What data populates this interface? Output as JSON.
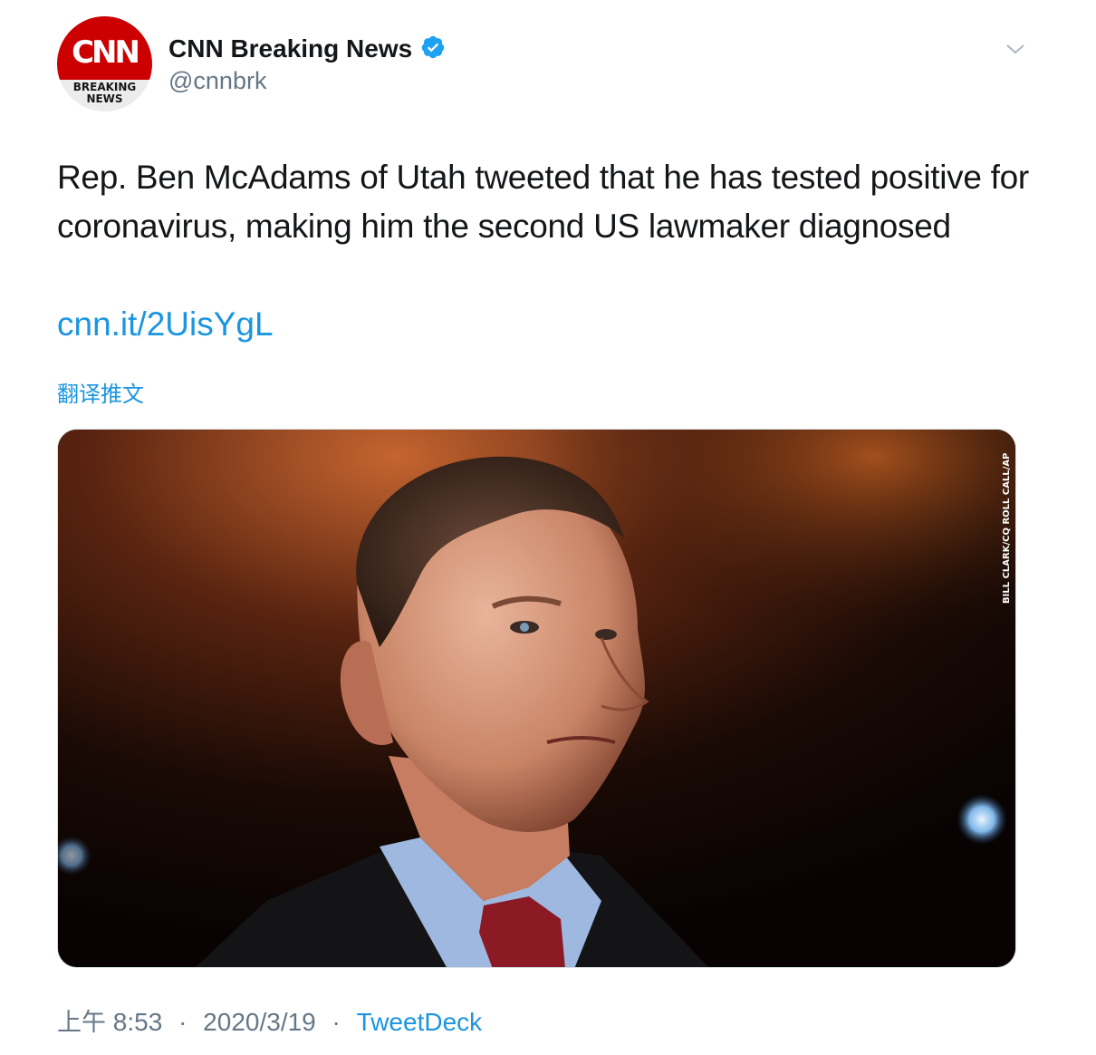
{
  "author": {
    "avatar": {
      "logo_text": "CNN",
      "sub_line1": "BREAKING",
      "sub_line2": "NEWS",
      "brand_color": "#cc0000"
    },
    "display_name": "CNN Breaking News",
    "handle": "@cnnbrk",
    "verified": true,
    "verified_color": "#1da1f2"
  },
  "tweet": {
    "text": "Rep. Ben McAdams of Utah tweeted that he has tested positive for coronavirus, making him the second US lawmaker diagnosed",
    "link": "cnn.it/2UisYgL",
    "translate_label": "翻译推文",
    "photo": {
      "description_icon": "portrait-photo",
      "credit": "BILL CLARK/CQ ROLL CALL/AP"
    }
  },
  "footer": {
    "time_prefix": "上午",
    "time": "8:53",
    "separator": "·",
    "date": "2020/3/19",
    "source": "TweetDeck"
  },
  "colors": {
    "link": "#1b95e0",
    "secondary_text": "#657786",
    "primary_text": "#14171a"
  }
}
